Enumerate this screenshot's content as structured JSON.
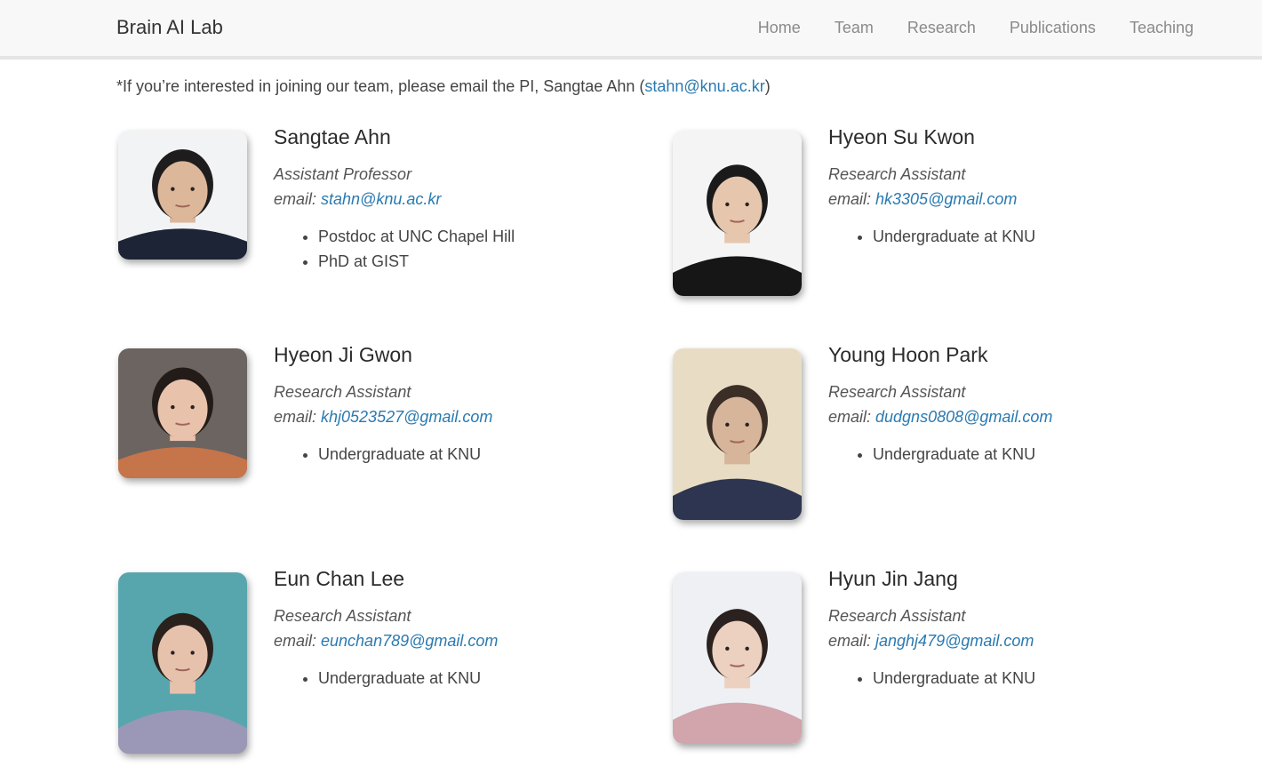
{
  "nav": {
    "brand": "Brain AI Lab",
    "links": [
      "Home",
      "Team",
      "Research",
      "Publications",
      "Teaching"
    ]
  },
  "notice": {
    "prefix": "*If you’re interested in joining our team, please email the PI, Sangtae Ahn (",
    "email": "stahn@knu.ac.kr",
    "suffix": ")"
  },
  "colors": {
    "link": "#2a7ab0",
    "navbar_bg": "#f8f8f8",
    "text": "#333333"
  },
  "members": [
    {
      "name": "Sangtae Ahn",
      "role": "Assistant Professor",
      "email_label": "email: ",
      "email": "stahn@knu.ac.kr",
      "details": [
        "Postdoc at UNC Chapel Hill",
        "PhD at GIST"
      ],
      "photo": {
        "bg": "#f2f3f5",
        "skin": "#dcb79a",
        "hair": "#1e1c1c",
        "shirt": "#1d2435"
      }
    },
    {
      "name": "Hyeon Su Kwon",
      "role": "Research Assistant",
      "email_label": "email: ",
      "email": "hk3305@gmail.com",
      "details": [
        "Undergraduate at KNU"
      ],
      "photo": {
        "bg": "#f4f4f4",
        "skin": "#e6c7ae",
        "hair": "#1a1a1a",
        "shirt": "#161616"
      }
    },
    {
      "name": "Hyeon Ji Gwon",
      "role": "Research Assistant",
      "email_label": "email: ",
      "email": "khj0523527@gmail.com",
      "details": [
        "Undergraduate at KNU"
      ],
      "photo": {
        "bg": "#6b6460",
        "skin": "#e8c2aa",
        "hair": "#231b18",
        "shirt": "#c6744a"
      }
    },
    {
      "name": "Young Hoon Park",
      "role": "Research Assistant",
      "email_label": "email: ",
      "email": "dudgns0808@gmail.com",
      "details": [
        "Undergraduate at KNU"
      ],
      "photo": {
        "bg": "#e8ddc4",
        "skin": "#d7b59b",
        "hair": "#3a2e26",
        "shirt": "#2e3550"
      }
    },
    {
      "name": "Eun Chan Lee",
      "role": "Research Assistant",
      "email_label": "email: ",
      "email": "eunchan789@gmail.com",
      "details": [
        "Undergraduate at KNU"
      ],
      "photo": {
        "bg": "#58a6ad",
        "skin": "#e6c2ad",
        "hair": "#2a201c",
        "shirt": "#9a98b6"
      }
    },
    {
      "name": "Hyun Jin Jang",
      "role": "Research Assistant",
      "email_label": "email: ",
      "email": "janghj479@gmail.com",
      "details": [
        "Undergraduate at KNU"
      ],
      "photo": {
        "bg": "#eef0f4",
        "skin": "#ecd0c0",
        "hair": "#2b2220",
        "shirt": "#d2a4ac"
      }
    }
  ]
}
